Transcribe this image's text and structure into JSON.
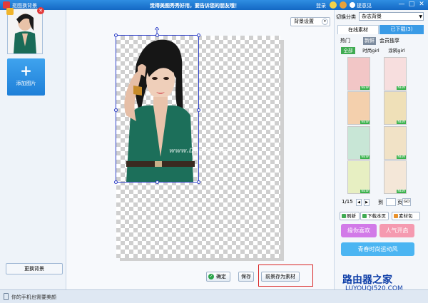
{
  "window": {
    "title": "抠图换背景",
    "promo": "觉得美图秀秀好用，要告诉您的朋友哦！",
    "login": "登录",
    "feedback": "提意见",
    "min_label": "—",
    "max_label": "□",
    "close_label": "✕"
  },
  "left_panel": {
    "add_image_plus": "+",
    "add_image": "添加图片",
    "change_background": "更换背景",
    "delete_mark": "✕"
  },
  "canvas": {
    "background_settings": "背景设置",
    "dropdown_arrow": "▾",
    "watermark": "www.DuoTe.com",
    "confirm_check": "✓",
    "confirm": "确定",
    "save": "保存",
    "save_as_material": "前景存为素材"
  },
  "right_panel": {
    "category_label": "切换分类",
    "category_value": "杂志背景",
    "category_arrow": "▼",
    "tabs": [
      "在线素材",
      "已下载(3)"
    ],
    "subtabs": [
      "热门",
      "新鲜",
      "会员独享"
    ],
    "filters": [
      "全部",
      "时尚girl",
      "涂鸦girl"
    ],
    "new_tag": "NEW",
    "pager": {
      "count": "1/15",
      "prev": "◀",
      "next": "▶",
      "goto_label": "到",
      "page_label": "页",
      "go": "GO"
    },
    "actions": [
      "刷新",
      "下载本页",
      "素材包"
    ],
    "promos": [
      "缘你喜欢",
      "人气开启",
      "青春时尚运动风"
    ]
  },
  "statusbar": {
    "text": "你的手机也需要美颜"
  },
  "site_logo": {
    "name": "路由器之家",
    "url": "LUYOUQI520.COM"
  },
  "colors": {
    "title_bar": "#1e78d2",
    "accent_blue": "#3a9be6",
    "selection": "#2d3fc7",
    "highlight_box": "#d92424",
    "filter_green": "#3fab52"
  }
}
